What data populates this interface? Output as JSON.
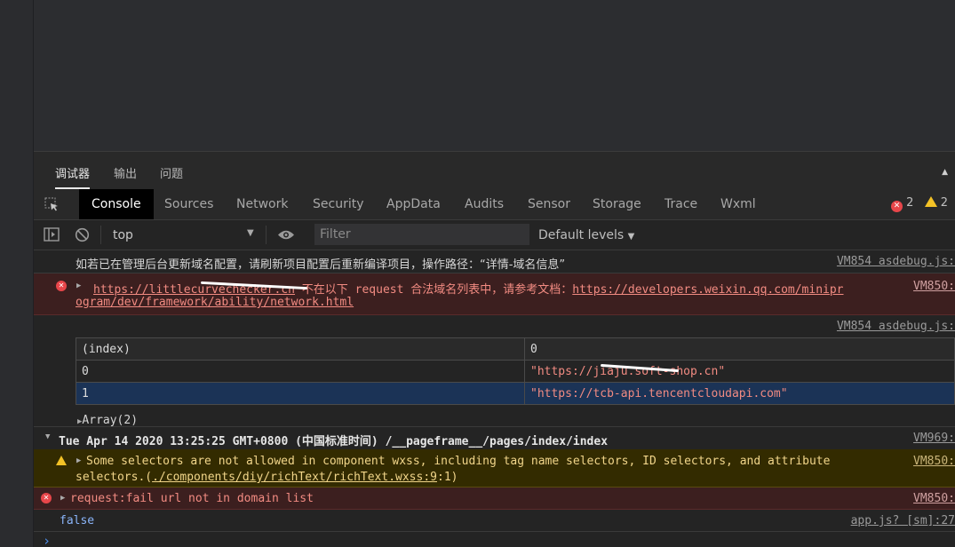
{
  "panel_tabs": [
    "调试器",
    "输出",
    "问题"
  ],
  "devtools_tabs": [
    "Console",
    "Sources",
    "Network",
    "Security",
    "AppData",
    "Audits",
    "Sensor",
    "Storage",
    "Trace",
    "Wxml"
  ],
  "counts": {
    "errors": "2",
    "warnings": "2"
  },
  "toolbar": {
    "context": "top",
    "filter_placeholder": "Filter",
    "levels": "Default levels"
  },
  "console": {
    "line1": {
      "text": "如若已在管理后台更新域名配置，请刷新项目配置后重新编译项目，操作路径：“详情-域名信息”",
      "source": "VM854 asdebug.js:"
    },
    "line2": {
      "url": "https://littlecurvechecker.cn",
      "msg": " 不在以下 request 合法域名列表中，请参考文档：",
      "doc_a": "https://developers.weixin.qq.com/minipr",
      "doc_b": "ogram/dev/framework/ability/network.html",
      "source": "VM850:"
    },
    "table_source": "VM854 asdebug.js:",
    "table": {
      "headers": [
        "(index)",
        "0"
      ],
      "rows": [
        {
          "index": "0",
          "value": "\"https://jiaju.soft-shop.cn\""
        },
        {
          "index": "1",
          "value": "\"https://tcb-api.tencentcloudapi.com\""
        }
      ]
    },
    "array_label": "Array(2)",
    "group": {
      "text": "Tue Apr 14 2020 13:25:25 GMT+0800 (中国标准时间) /__pageframe__/pages/index/index",
      "source": "VM969:"
    },
    "warn": {
      "text_a": "Some selectors are not allowed in component wxss, including tag name selectors, ID selectors, and attribute",
      "text_b_pre": "selectors.(",
      "text_b_link": "./components/diy/richText/richText.wxss:9",
      "text_b_post": ":1)",
      "source": "VM850:"
    },
    "err2": {
      "text": "request:fail url not in domain list",
      "source": "VM850:"
    },
    "false_line": {
      "text": "false",
      "source": "app.js? [sm]:27"
    },
    "prompt": "›"
  },
  "colors": {
    "error_bg": "#3c1f1f",
    "warn_bg": "#332b00",
    "accent": "#e8464a",
    "warn": "#f3c226"
  }
}
